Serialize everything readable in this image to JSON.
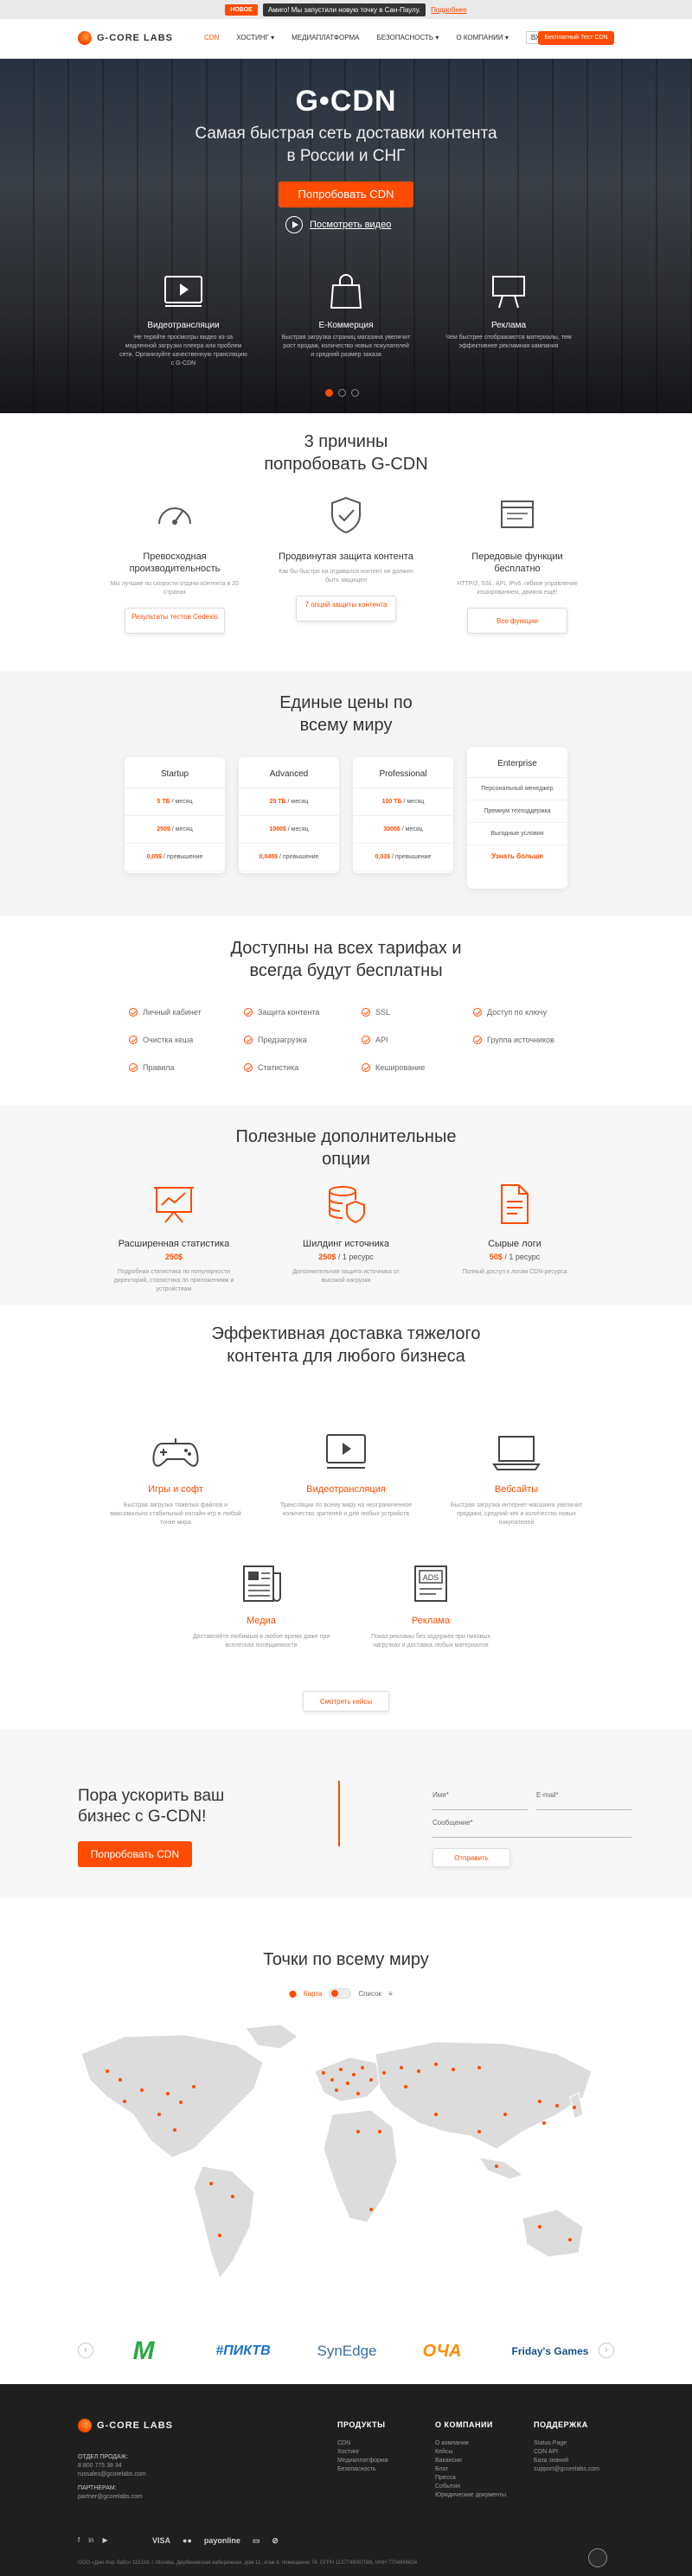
{
  "announcement": {
    "tag": "НОВОЕ",
    "message": "Амиго! Мы запустили новую точку в Сан-Паулу.",
    "link": "Подробнее"
  },
  "header": {
    "logo": "G-CORE LABS",
    "nav": [
      "CDN",
      "ХОСТИНГ ▾",
      "МЕДИАПЛАТФОРМА",
      "БЕЗОПАСНОСТЬ ▾",
      "О КОМПАНИИ ▾"
    ],
    "login": "ВХОД ▾",
    "free_test": "Бесплатный Тест CDN"
  },
  "hero": {
    "title": "G•CDN",
    "subtitle_line1": "Самая быстрая сеть доставки контента",
    "subtitle_line2": "в России и СНГ",
    "try_button": "Попробовать CDN",
    "video_link": "Посмотреть видео",
    "features": [
      {
        "icon": "video-player-icon",
        "title": "Видеотрансляции",
        "desc": "Не теряйте просмотры видео из-за медленной загрузки плеера или проблем сети. Организуйте качественную трансляцию с G-CDN"
      },
      {
        "icon": "shopping-bag-icon",
        "title": "E-Коммерция",
        "desc": "Быстрая загрузка страниц магазина увеличит рост продаж, количество новых покупателей и средний размер заказа"
      },
      {
        "icon": "billboard-icon",
        "title": "Реклама",
        "desc": "Чем быстрее отображаются материалы, тем эффективнее рекламная кампания"
      }
    ],
    "slide_count": 3,
    "active_slide": 1
  },
  "reasons": {
    "title_line1": "3 причины",
    "title_line2": "попробовать G-CDN",
    "items": [
      {
        "icon": "speedometer-icon",
        "title": "Превосходная производительность",
        "desc": "Мы лучшие по скорости отдачи контента в 20 странах",
        "button": "Результаты тестов Cedexis"
      },
      {
        "icon": "shield-check-icon",
        "title": "Продвинутая защита контента",
        "desc": "Как бы быстро ни отдавался контент он должен быть защищен",
        "button": "7 опций защиты контента"
      },
      {
        "icon": "browser-window-icon",
        "title": "Передовые функции бесплатно",
        "desc": "HTTP/2, SSL, API, IPv6, гибкое управление кэшированием, движок ещё!",
        "button": "Все функции"
      }
    ]
  },
  "prices": {
    "title_line1": "Единые цены по",
    "title_line2": "всему миру",
    "plans": [
      {
        "name": "Startup",
        "rows": [
          [
            "5 ТБ",
            "/ месяц"
          ],
          [
            "250$",
            "/ месяц"
          ],
          [
            "0,05$",
            "/ превышение"
          ]
        ]
      },
      {
        "name": "Advanced",
        "rows": [
          [
            "25 ТБ",
            "/ месяц"
          ],
          [
            "1000$",
            "/ месяц"
          ],
          [
            "0,045$",
            "/ превышение"
          ]
        ]
      },
      {
        "name": "Professional",
        "rows": [
          [
            "100 ТБ",
            "/ месяц"
          ],
          [
            "3000$",
            "/ месяц"
          ],
          [
            "0,03$",
            "/ превышение"
          ]
        ]
      }
    ],
    "enterprise": {
      "name": "Enterprise",
      "rows": [
        "Персональный менеджер",
        "Премиум техподдержка",
        "Выгодные условия"
      ],
      "link": "Узнать больше"
    }
  },
  "free": {
    "title_line1": "Доступны на всех тарифах и",
    "title_line2": "всегда будут бесплатны",
    "columns": [
      [
        "Личный кабинет",
        "Очистка кеша",
        "Правила"
      ],
      [
        "Защита контента",
        "Предзагрузка",
        "Статистика"
      ],
      [
        "SSL",
        "API",
        "Кеширование"
      ],
      [
        "Доступ по ключу",
        "Группа источников"
      ]
    ]
  },
  "options": {
    "title_line1": "Полезные дополнительные",
    "title_line2": "опции",
    "items": [
      {
        "icon": "presentation-chart-icon",
        "title": "Расширенная статистика",
        "price": "250$",
        "price_suffix": "",
        "desc": "Подробная статистика по популярности директорий, статистика по приложениям и устройствам"
      },
      {
        "icon": "database-shield-icon",
        "title": "Шилдинг источника",
        "price": "250$",
        "price_suffix": "/ 1 ресурс",
        "desc": "Дополнительная защита источника от высокой нагрузки"
      },
      {
        "icon": "document-log-icon",
        "title": "Сырые логи",
        "price": "50$",
        "price_suffix": "/ 1 ресурс",
        "desc": "Полный доступ к логам CDN-ресурса"
      }
    ]
  },
  "delivery": {
    "title_line1": "Эффективная доставка тяжелого",
    "title_line2": "контента для любого бизнеса",
    "items": [
      {
        "icon": "gamepad-icon",
        "title": "Игры и софт",
        "desc": "Быстрая загрузка тяжелых файлов и максимально стабильный онлайн-игр в любой точке мира"
      },
      {
        "icon": "video-player-icon",
        "title": "Видеотрансляция",
        "desc": "Трансляции по всему миру на неограниченное количество зрителей и для любых устройств"
      },
      {
        "icon": "laptop-icon",
        "title": "Вебсайты",
        "desc": "Быстрая загрузка интернет-магазина увеличит продажи, средний чек и количество новых покупателей"
      },
      {
        "icon": "newspaper-icon",
        "title": "Медиа",
        "desc": "Доставляйте любимым в любое время даже при всплесках посещаемости"
      },
      {
        "icon": "ads-icon",
        "title": "Реклама",
        "desc": "Показ рекламы без задержек при пиковых нагрузках и доставка любых материалов"
      }
    ],
    "cases_button": "Смотреть кейсы"
  },
  "cta": {
    "headline_line1": "Пора ускорить ваш",
    "headline_line2": "бизнес с G-CDN!",
    "button": "Попробовать CDN",
    "name_label": "Имя*",
    "email_label": "E-mail*",
    "message_label": "Сообщение*",
    "send": "Отправить"
  },
  "map": {
    "title": "Точки по всему миру",
    "toggle_left": "Карта",
    "toggle_right": "Список"
  },
  "partners": [
    "M",
    "#ПИКТВ",
    "SynEdge",
    "ОЧА",
    "Friday's Games"
  ],
  "footer": {
    "logo": "G-CORE LABS",
    "sales_label": "ОТДЕЛ ПРОДАЖ:",
    "sales_phone": "8 800 775 38 34",
    "sales_email": "russales@gcorelabs.com",
    "partners_label": "ПАРТНЕРАМ:",
    "partners_email": "partner@gcorelabs.com",
    "columns": [
      {
        "title": "ПРОДУКТЫ",
        "links": [
          "CDN",
          "Хостинг",
          "Медиаплатформа",
          "Безопасность"
        ]
      },
      {
        "title": "О КОМПАНИИ",
        "links": [
          "О компании",
          "Кейсы",
          "Вакансии",
          "Блог",
          "Пресса",
          "События",
          "Юридические документы"
        ]
      },
      {
        "title": "ПОДДЕРЖКА",
        "links": [
          "Status Page",
          "CDN API",
          "База знаний",
          "support@gcorelabs.com"
        ]
      }
    ],
    "social": [
      "f",
      "in",
      "▶"
    ],
    "payments": [
      "VISA",
      "●●",
      "payonline",
      "▭",
      "⊘"
    ],
    "copyright": "ООО «Джи-Кор Лабс» 115114, г. Москва, Дербеневская набережная, дом 11, этаж 8, помещение 74. ОГРН 1137746097086, ИНН 7704846634"
  },
  "colors": {
    "accent": "#ff4c00",
    "dark": "#1f1f1f"
  }
}
